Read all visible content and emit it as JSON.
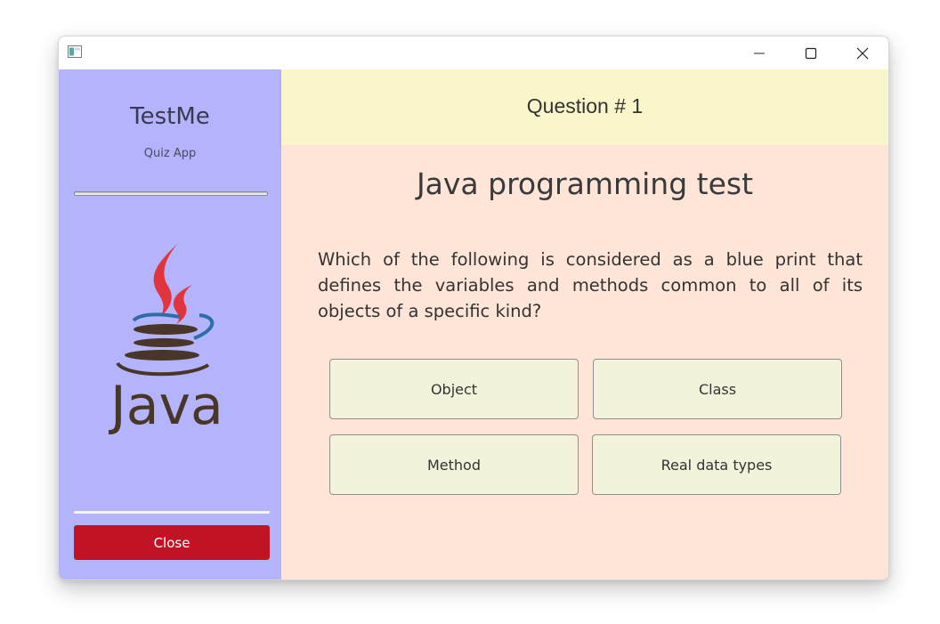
{
  "window": {
    "controls": {
      "minimize_icon": "minimize-icon",
      "maximize_icon": "maximize-icon",
      "close_icon": "close-icon"
    }
  },
  "sidebar": {
    "app_name": "TestMe",
    "subtitle": "Quiz App",
    "progress": 0,
    "logo": "Java",
    "close_button": "Close",
    "background": "#b4b4fd",
    "close_button_color": "#c21325"
  },
  "header": {
    "question_number": "Question # 1",
    "background": "#f9f6cc"
  },
  "quiz": {
    "title": "Java programming test",
    "question": "Which of the following is considered as a blue print that defines the variables and methods common to all of its objects of a specific kind?",
    "answers": [
      "Object",
      "Class",
      "Method",
      "Real data types"
    ],
    "background": "#fee5d8",
    "answer_background": "#f3f3dc"
  }
}
